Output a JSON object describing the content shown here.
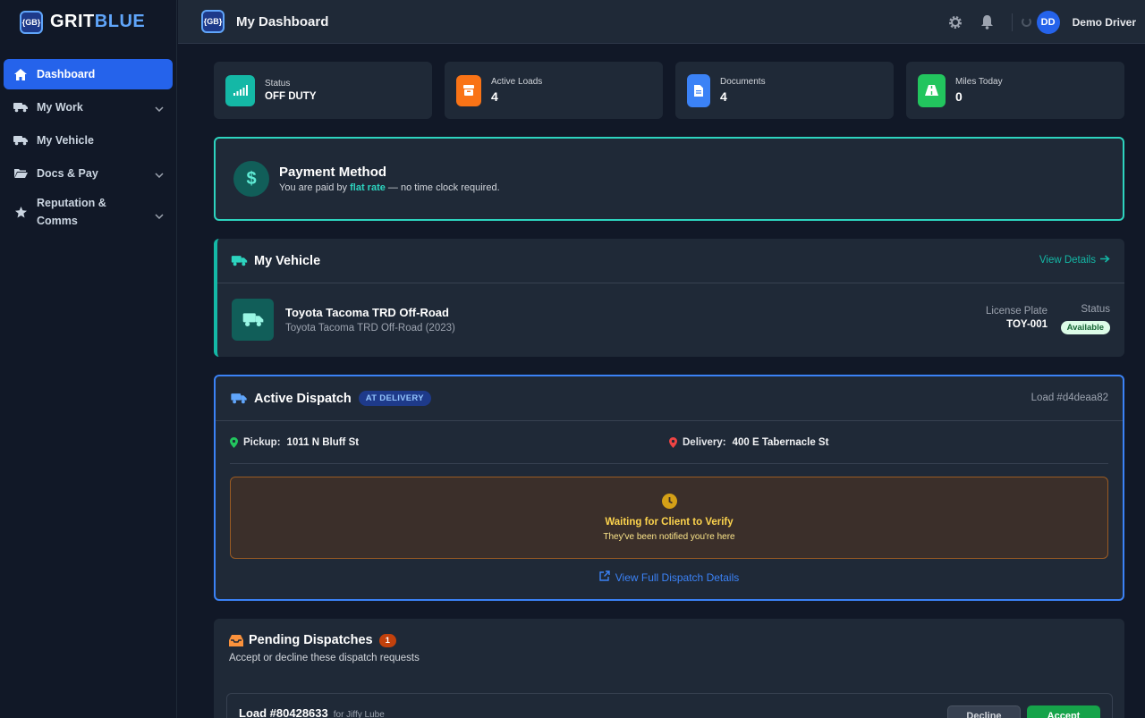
{
  "brand": {
    "logo": "{GB}",
    "name_a": "GRIT",
    "name_b": "BLUE"
  },
  "sidebar": {
    "items": [
      {
        "label": "Dashboard",
        "icon": "home-icon",
        "active": true
      },
      {
        "label": "My Work",
        "icon": "truck-icon"
      },
      {
        "label": "My Vehicle",
        "icon": "truck-icon"
      },
      {
        "label": "Docs & Pay",
        "icon": "folder-icon"
      },
      {
        "label": "Reputation &",
        "label2": "Comms",
        "icon": "star-icon"
      }
    ]
  },
  "topbar": {
    "logo": "{GB}",
    "title": "My Dashboard",
    "avatar_initials": "DD",
    "user_name": "Demo Driver"
  },
  "stats": [
    {
      "label": "Status",
      "value": "OFF DUTY",
      "color": "#14b8a6",
      "icon": "signal-icon"
    },
    {
      "label": "Active Loads",
      "value": "4",
      "color": "#f97316",
      "icon": "box-icon"
    },
    {
      "label": "Documents",
      "value": "4",
      "color": "#3b82f6",
      "icon": "document-icon"
    },
    {
      "label": "Miles Today",
      "value": "0",
      "color": "#22c55e",
      "icon": "road-icon"
    }
  ],
  "payment": {
    "title": "Payment Method",
    "sub_prefix": "You are paid by",
    "sub_highlight": "flat rate",
    "sub_suffix": "— no time clock required.",
    "icon_glyph": "$"
  },
  "vehicle": {
    "section_title": "My Vehicle",
    "view_details": "View Details",
    "name": "Toyota Tacoma TRD Off-Road",
    "model": "Toyota Tacoma TRD Off-Road (2023)",
    "plate_label": "License Plate",
    "plate": "TOY-001",
    "status_label": "Status",
    "status": "Available"
  },
  "dispatch": {
    "title": "Active Dispatch",
    "tag": "AT DELIVERY",
    "load": "Load #d4deaa82",
    "pickup_label": "Pickup:",
    "pickup": "1011 N Bluff St",
    "delivery_label": "Delivery:",
    "delivery": "400 E Tabernacle St",
    "wait_title": "Waiting for Client to Verify",
    "wait_sub": "They've been notified you're here",
    "full_link": "View Full Dispatch Details"
  },
  "pending": {
    "title": "Pending Dispatches",
    "count": "1",
    "sub": "Accept or decline these dispatch requests",
    "card_load": "Load #80428633",
    "card_for": "for Jiffy Lube",
    "decline": "Decline",
    "accept": "Accept"
  }
}
